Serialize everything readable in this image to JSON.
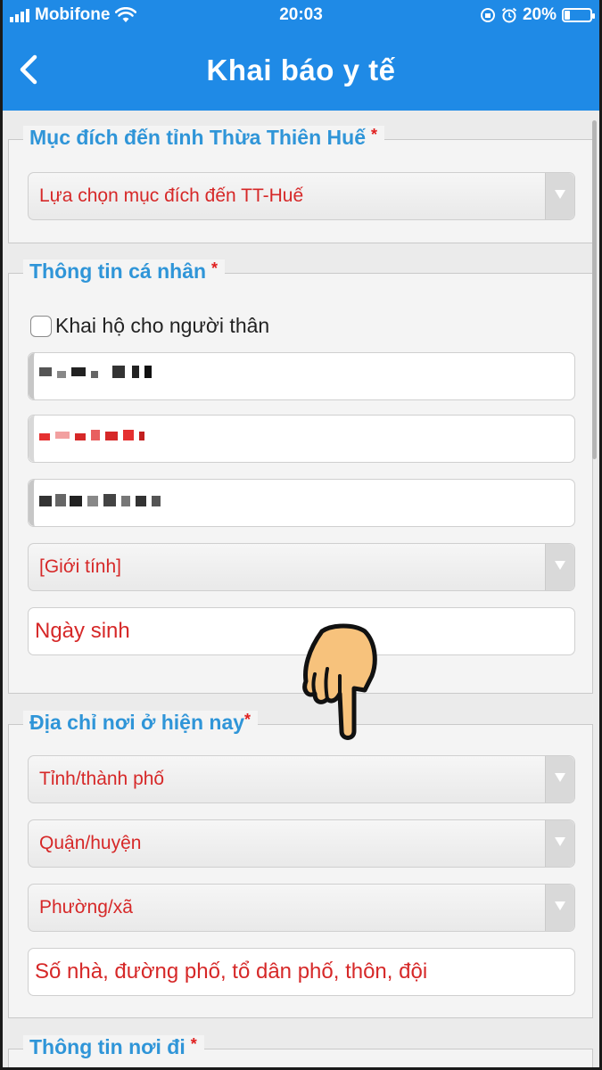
{
  "status_bar": {
    "carrier": "Mobifone",
    "time": "20:03",
    "battery": "20%"
  },
  "header": {
    "back_icon": "chevron-left-icon",
    "title": "Khai báo y tế"
  },
  "sections": {
    "purpose": {
      "legend": "Mục đích đến tỉnh Thừa Thiên Huế",
      "required_mark": "*",
      "select_value": "Lựa chọn mục đích đến TT-Huế"
    },
    "personal": {
      "legend": "Thông tin cá nhân",
      "required_mark": "*",
      "checkbox_label": "Khai hộ cho người thân",
      "gender_select": "[Giới tính]",
      "birthdate_placeholder": "Ngày sinh"
    },
    "address": {
      "legend": "Địa chỉ nơi ở hiện nay",
      "required_mark": "*",
      "province_select": "Tỉnh/thành phố",
      "district_select": "Quận/huyện",
      "ward_select": "Phường/xã",
      "street_placeholder": "Số nhà, đường phố, tổ dân phố, thôn, đội"
    },
    "departure": {
      "legend": "Thông tin nơi đi",
      "required_mark": "*"
    }
  },
  "colors": {
    "header_bg": "#1f8ae6",
    "legend": "#2f95d8",
    "placeholder": "#d62828",
    "required": "#e02020"
  }
}
